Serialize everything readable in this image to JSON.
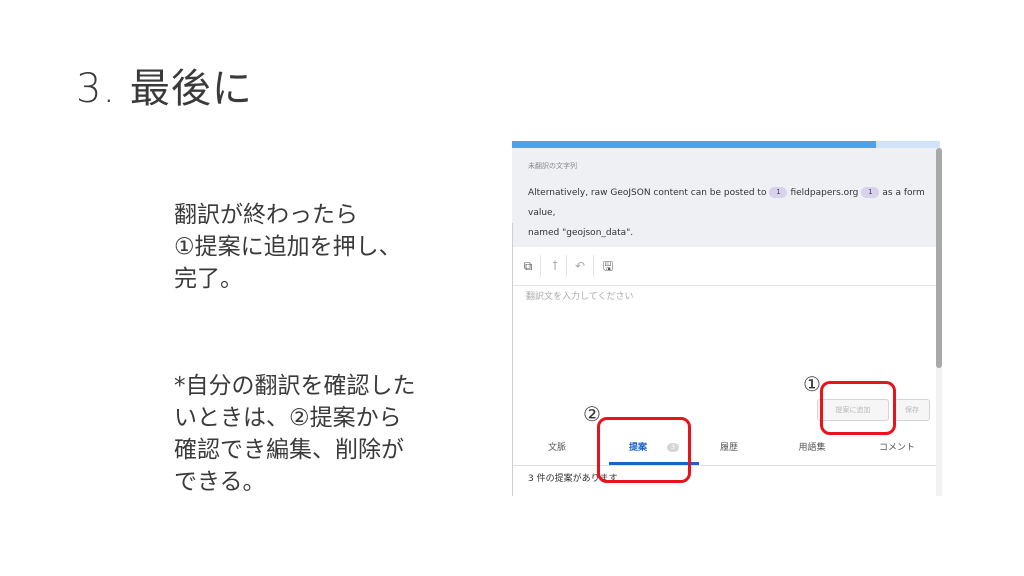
{
  "slide": {
    "title": "3. 最後に",
    "note_top": [
      "翻訳が終わったら",
      "①提案に追加を押し、",
      "完了。"
    ],
    "note_bottom": [
      "*自分の翻訳を確認した",
      "いときは、②提案から",
      "確認でき編集、削除が",
      "できる。"
    ]
  },
  "app": {
    "progress_percent": 85,
    "colors": {
      "accent": "#1a63c7",
      "progress": "#4aa3ee",
      "callout": "#e8131c"
    },
    "source": {
      "label": "未翻訳の文字列",
      "text_1": "Alternatively, raw GeoJSON content can be posted to",
      "tag_1": "1",
      "link_text": "fieldpapers.org",
      "tag_2": "1",
      "text_2": "as a form value,",
      "text_3": "named \"geojson_data\"."
    },
    "toolbar": {
      "copy_icon": "⧉",
      "special_char_icon": "ꝉ",
      "undo_icon": "↶",
      "save_icon": "🖫"
    },
    "editor": {
      "value": "",
      "placeholder": "翻訳文を入力してください"
    },
    "buttons": {
      "add_suggestion": "提案に追加",
      "save": "保存"
    },
    "tabs": [
      {
        "label": "文脈"
      },
      {
        "label": "提案",
        "count": "3"
      },
      {
        "label": "履歴"
      },
      {
        "label": "用語集"
      },
      {
        "label": "コメント"
      }
    ],
    "suggestion_count": "3 件の提案があります"
  },
  "callouts": {
    "mark_1": "①",
    "mark_2": "②"
  }
}
